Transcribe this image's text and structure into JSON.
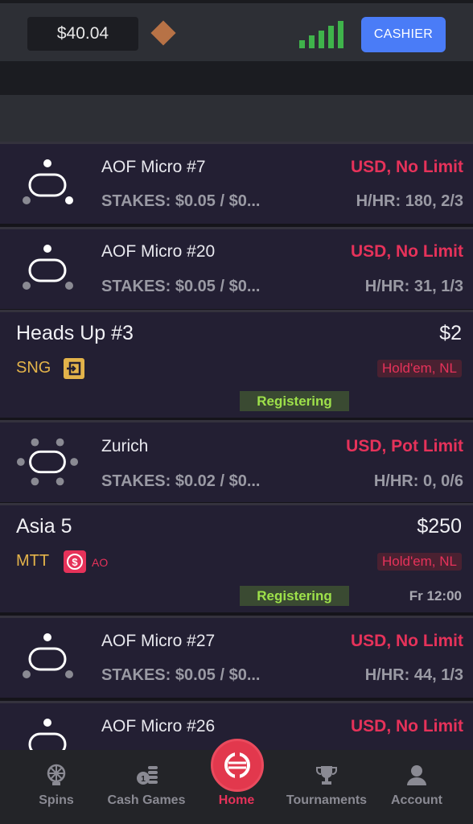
{
  "header": {
    "balance": "$40.04",
    "cashier_label": "CASHIER",
    "signal_level": 5
  },
  "cash_tables": [
    {
      "name": "AOF Micro #7",
      "type": "USD, No Limit",
      "stakes": "STAKES: $0.05 / $0...",
      "hhr": "H/HR: 180, 2/3"
    },
    {
      "name": "AOF Micro #20",
      "type": "USD, No Limit",
      "stakes": "STAKES: $0.05 / $0...",
      "hhr": "H/HR: 31, 1/3"
    },
    {
      "name": "Zurich",
      "type": "USD, Pot Limit",
      "stakes": "STAKES: $0.02 / $0...",
      "hhr": "H/HR: 0, 0/6"
    },
    {
      "name": "AOF Micro #27",
      "type": "USD, No Limit",
      "stakes": "STAKES: $0.05 / $0...",
      "hhr": "H/HR: 44, 1/3"
    },
    {
      "name": "AOF Micro #26",
      "type": "USD, No Limit"
    }
  ],
  "tournaments": [
    {
      "name": "Heads Up #3",
      "price": "$2",
      "type": "SNG",
      "game": "Hold'em, NL",
      "status": "Registering"
    },
    {
      "name": "Asia 5",
      "price": "$250",
      "type": "MTT",
      "extra": "AO",
      "game": "Hold'em, NL",
      "status": "Registering",
      "time": "Fr 12:00"
    }
  ],
  "nav": {
    "spins": "Spins",
    "cash_games": "Cash Games",
    "home": "Home",
    "tournaments": "Tournaments",
    "account": "Account"
  },
  "colors": {
    "accent_red": "#e6325a",
    "cashier_blue": "#4a7cf7",
    "signal_green": "#3fb34b",
    "registering_green": "#9ee14a",
    "tournament_type_gold": "#e3b34a"
  }
}
